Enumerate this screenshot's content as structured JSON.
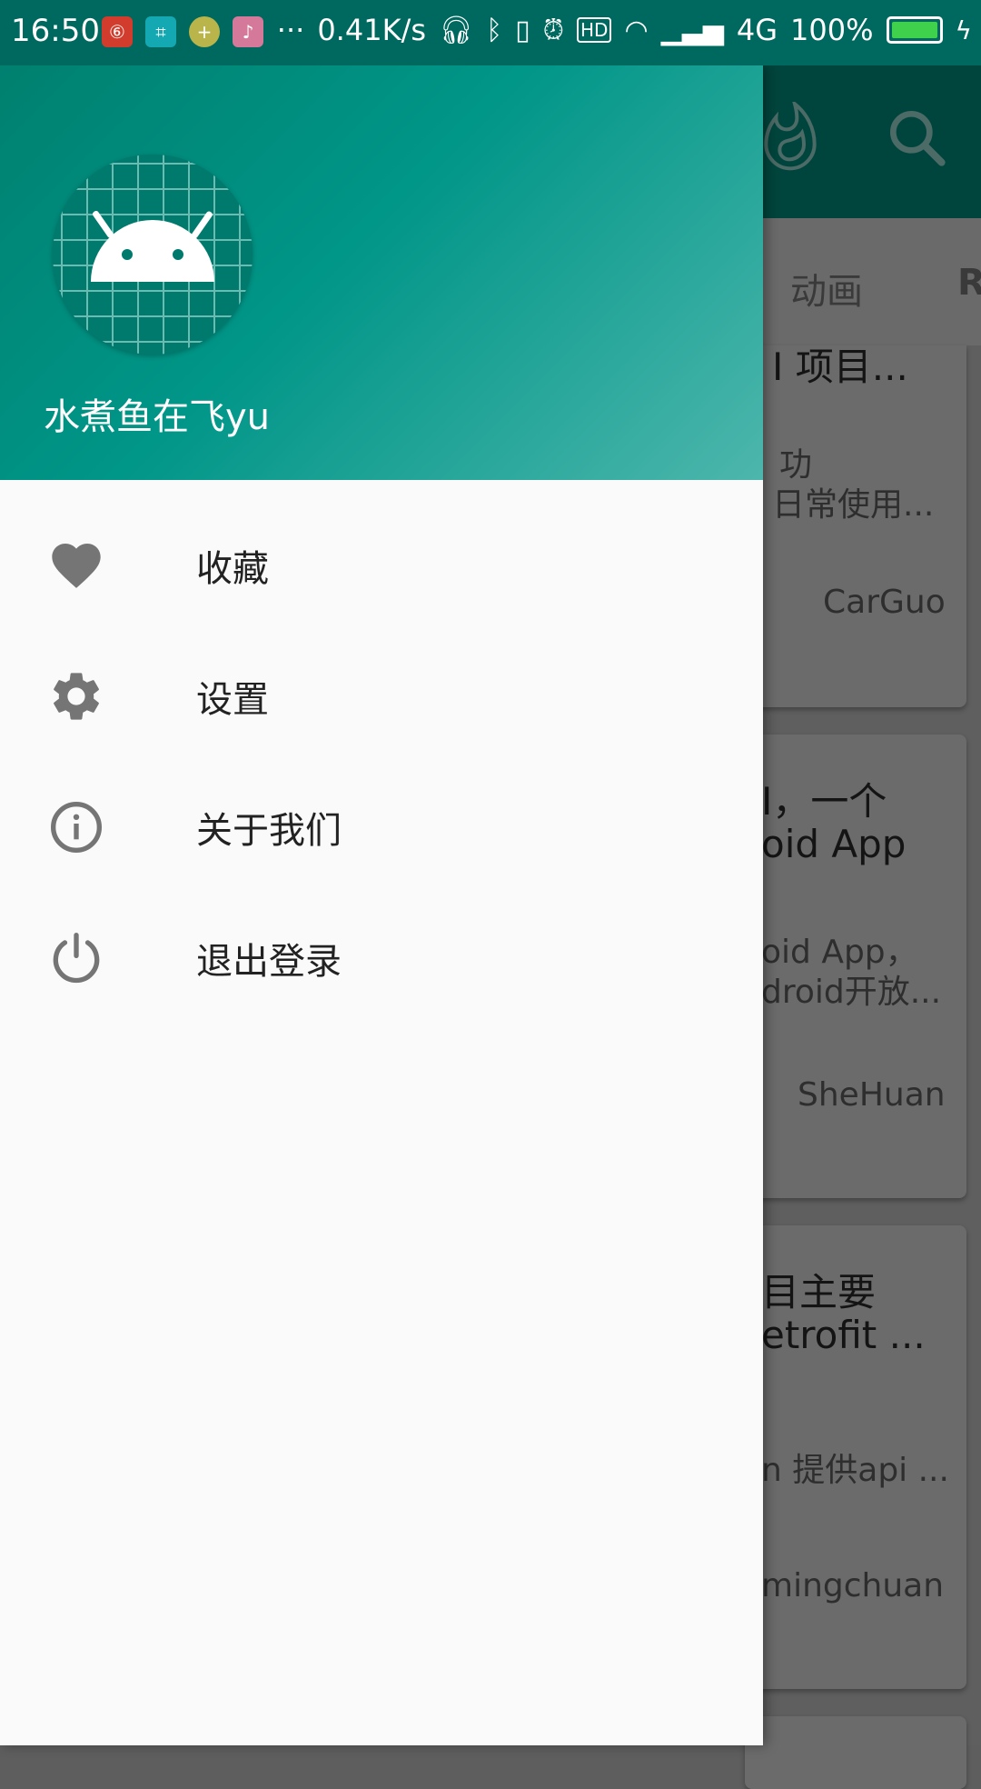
{
  "status_bar": {
    "time": "16:50",
    "net_speed": "0.41K/s",
    "network": "4G",
    "battery": "100%",
    "apps": [
      {
        "name": "weibo-app-icon",
        "color": "#d23c2d",
        "glyph": "⑥"
      },
      {
        "name": "scan-app-icon",
        "color": "#13a8b2",
        "glyph": "⌗"
      },
      {
        "name": "add-app-icon",
        "color": "#b9b54a",
        "glyph": "+"
      },
      {
        "name": "pink-app-icon",
        "color": "#d5799a",
        "glyph": "♪"
      }
    ]
  },
  "drawer": {
    "username": "水煮鱼在飞yu",
    "menu": [
      {
        "icon": "heart-icon",
        "label": "收藏"
      },
      {
        "icon": "gear-icon",
        "label": "设置"
      },
      {
        "icon": "info-icon",
        "label": "关于我们"
      },
      {
        "icon": "power-icon",
        "label": "退出登录"
      }
    ]
  },
  "background": {
    "tabs": [
      "动画",
      "R"
    ],
    "cards": [
      {
        "title": "I 项目...",
        "desc_lines": [
          "功",
          "日常使用..."
        ],
        "author": "CarGuo"
      },
      {
        "title_lines": [
          "I，一个",
          "oid App"
        ],
        "desc_lines": [
          "oid App，",
          "droid开放..."
        ],
        "author": "SheHuan"
      },
      {
        "title_lines": [
          "目主要",
          "etrofit ..."
        ],
        "desc_lines": [
          "n 提供api ..."
        ],
        "author": "mingchuan"
      }
    ]
  },
  "colors": {
    "primary": "#009688",
    "primary_dark": "#00695f",
    "icon_gray": "#757575"
  }
}
